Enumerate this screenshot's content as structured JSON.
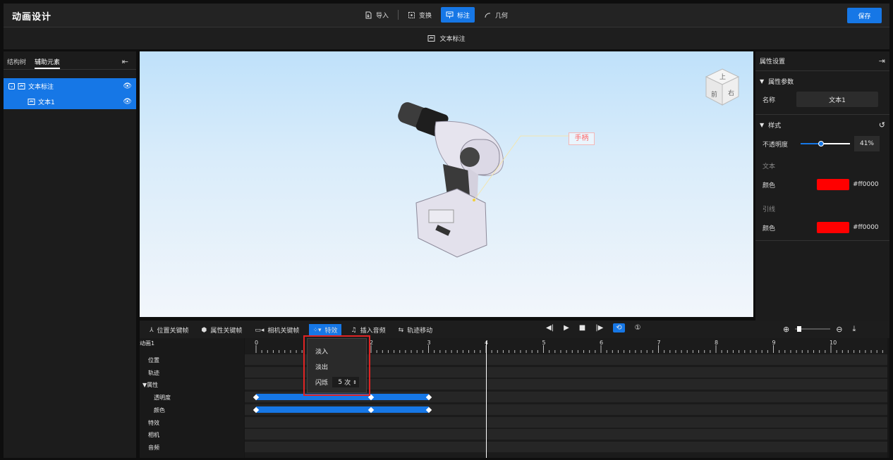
{
  "app": {
    "title": "动画设计",
    "save_label": "保存"
  },
  "toolbar": {
    "items": [
      {
        "label": "导入",
        "icon": "import-icon"
      },
      {
        "label": "变换",
        "icon": "transform-icon"
      },
      {
        "label": "标注",
        "icon": "annotation-icon",
        "active": true
      },
      {
        "label": "几何",
        "icon": "geometry-icon"
      }
    ]
  },
  "subbar": {
    "label": "文本标注"
  },
  "left_panel": {
    "tabs": [
      {
        "label": "结构树"
      },
      {
        "label": "辅助元素",
        "active": true
      }
    ],
    "tree": [
      {
        "label": "文本标注",
        "level": 0
      },
      {
        "label": "文本1",
        "level": 1
      }
    ]
  },
  "viewport": {
    "annotation_text": "手柄",
    "cube_faces": {
      "top": "上",
      "front": "前",
      "right": "右"
    }
  },
  "right_panel": {
    "title": "属性设置",
    "section_params": "属性参数",
    "name_label": "名称",
    "name_value": "文本1",
    "section_style": "样式",
    "opacity_label": "不透明度",
    "opacity_value": "41%",
    "opacity_fraction": 0.41,
    "text_group": "文本",
    "text_color_label": "颜色",
    "text_color_value": "#ff0000",
    "leader_group": "引线",
    "leader_color_label": "颜色",
    "leader_color_value": "#ff0000"
  },
  "timeline": {
    "toolbar": [
      {
        "label": "位置关键帧",
        "icon": "position-keyframe-icon"
      },
      {
        "label": "属性关键帧",
        "icon": "property-keyframe-icon"
      },
      {
        "label": "相机关键帧",
        "icon": "camera-keyframe-icon"
      },
      {
        "label": "特效",
        "icon": "effects-icon",
        "active": true
      },
      {
        "label": "插入音频",
        "icon": "audio-icon"
      },
      {
        "label": "轨迹移动",
        "icon": "track-move-icon"
      }
    ],
    "animation_name": "动画1",
    "tracks": [
      "位置",
      "轨迹",
      "▼属性",
      "透明度",
      "颜色",
      "特效",
      "相机",
      "音频"
    ],
    "ruler": [
      "0",
      "1",
      "2",
      "3",
      "4",
      "5",
      "6",
      "7",
      "8",
      "9",
      "10",
      "1"
    ],
    "playhead": 4,
    "keyframes": {
      "opacity": [
        0,
        2,
        3
      ],
      "color": [
        0,
        2,
        3
      ]
    },
    "zoom_fraction": 0.05
  },
  "effects_menu": {
    "fade_in": "淡入",
    "fade_out": "淡出",
    "blink_label": "闪烁",
    "blink_count": "5",
    "blink_unit": "次"
  },
  "colors": {
    "accent": "#1677e6",
    "annotation_red": "#ff0000"
  }
}
